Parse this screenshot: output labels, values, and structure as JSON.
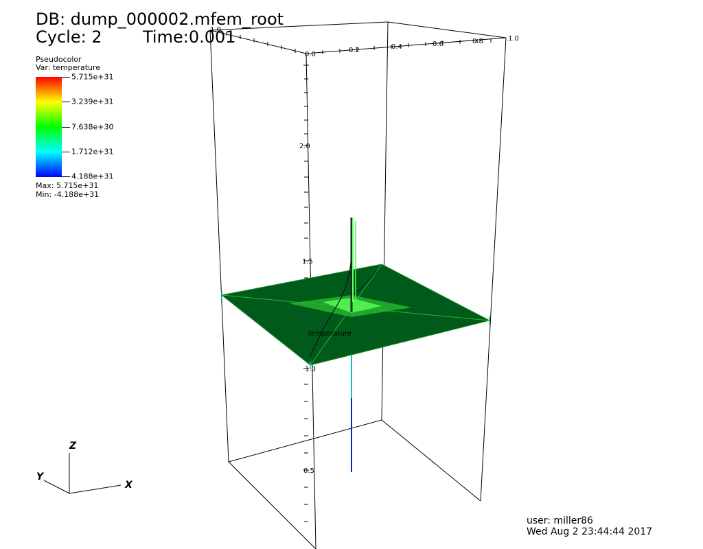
{
  "annotations": {
    "database": "DB: dump_000002.mfem_root",
    "cycle": "Cycle: 2",
    "time": "Time:0.001",
    "user": "user: miller86",
    "date": "Wed Aug  2 23:44:44 2017"
  },
  "legend": {
    "title": "Pseudocolor",
    "variable": "Var: temperature",
    "ticks": [
      "5.715e+31",
      "3.239e+31",
      "7.638e+30",
      "1.712e+31",
      "4.188e+31"
    ],
    "max": "Max: 5.715e+31",
    "min": "Min: -4.188e+31",
    "colors": [
      "#ff0000",
      "#ffff00",
      "#00ff00",
      "#00ffff",
      "#0000ff"
    ]
  },
  "scene": {
    "plot_label": "temperature",
    "plane_color": "#005a1a",
    "top_axis": {
      "ticks": [
        "1.0",
        "0.0",
        "0.2",
        "0.4",
        "0.6",
        "0.8",
        "1.0"
      ]
    },
    "vertical_axis": {
      "ticks": [
        "2.0",
        "1.5",
        "1.0",
        "0.5"
      ]
    },
    "triad": {
      "x": "X",
      "y": "Y",
      "z": "Z"
    }
  }
}
